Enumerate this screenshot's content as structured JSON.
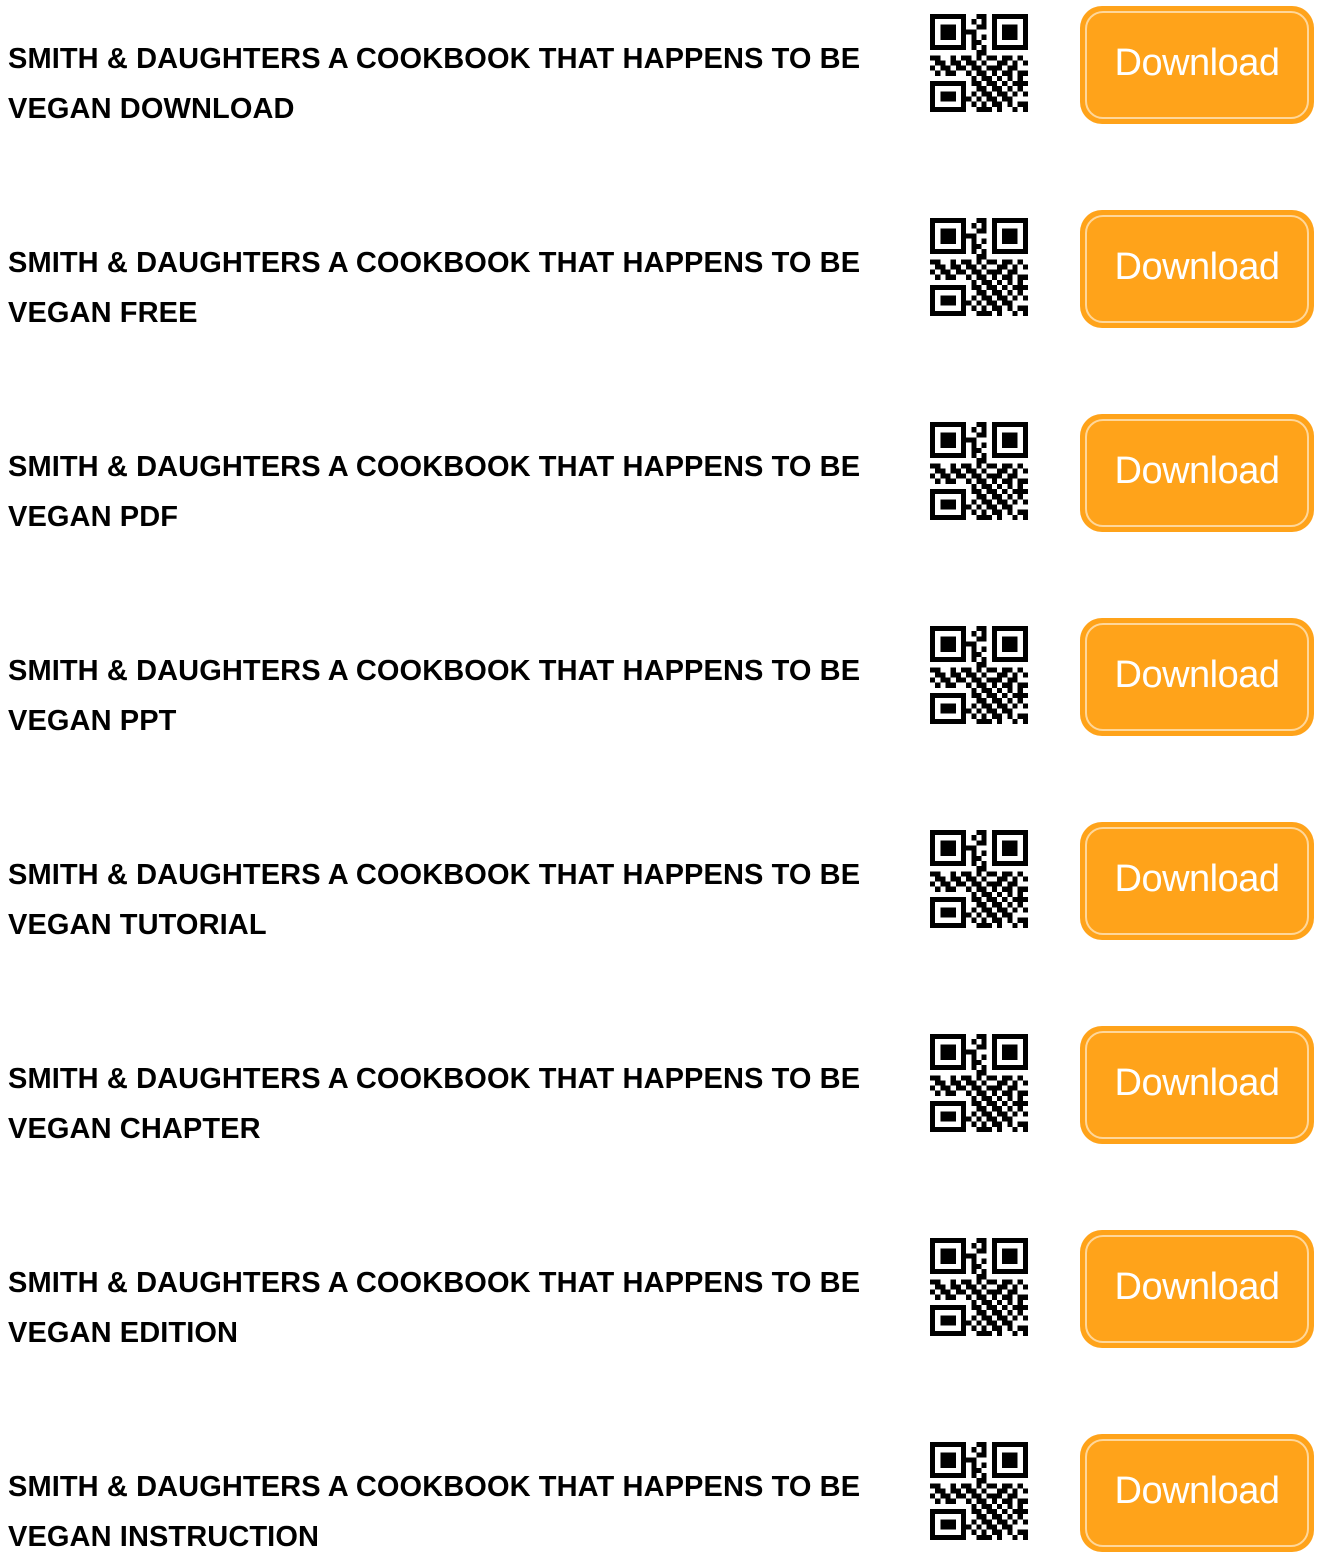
{
  "accent_color": "#FFA31A",
  "items": [
    {
      "title": "SMITH & DAUGHTERS A COOKBOOK THAT HAPPENS TO BE VEGAN DOWNLOAD",
      "button": "Download",
      "qr_icon": "qr-code-icon"
    },
    {
      "title": "SMITH & DAUGHTERS A COOKBOOK THAT HAPPENS TO BE VEGAN FREE",
      "button": "Download",
      "qr_icon": "qr-code-icon"
    },
    {
      "title": "SMITH & DAUGHTERS A COOKBOOK THAT HAPPENS TO BE VEGAN PDF",
      "button": "Download",
      "qr_icon": "qr-code-icon"
    },
    {
      "title": "SMITH & DAUGHTERS A COOKBOOK THAT HAPPENS TO BE VEGAN PPT",
      "button": "Download",
      "qr_icon": "qr-code-icon"
    },
    {
      "title": "SMITH & DAUGHTERS A COOKBOOK THAT HAPPENS TO BE VEGAN TUTORIAL",
      "button": "Download",
      "qr_icon": "qr-code-icon"
    },
    {
      "title": "SMITH & DAUGHTERS A COOKBOOK THAT HAPPENS TO BE VEGAN CHAPTER",
      "button": "Download",
      "qr_icon": "qr-code-icon"
    },
    {
      "title": "SMITH & DAUGHTERS A COOKBOOK THAT HAPPENS TO BE VEGAN EDITION",
      "button": "Download",
      "qr_icon": "qr-code-icon"
    },
    {
      "title": "SMITH & DAUGHTERS A COOKBOOK THAT HAPPENS TO BE VEGAN INSTRUCTION",
      "button": "Download",
      "qr_icon": "qr-code-icon"
    }
  ]
}
